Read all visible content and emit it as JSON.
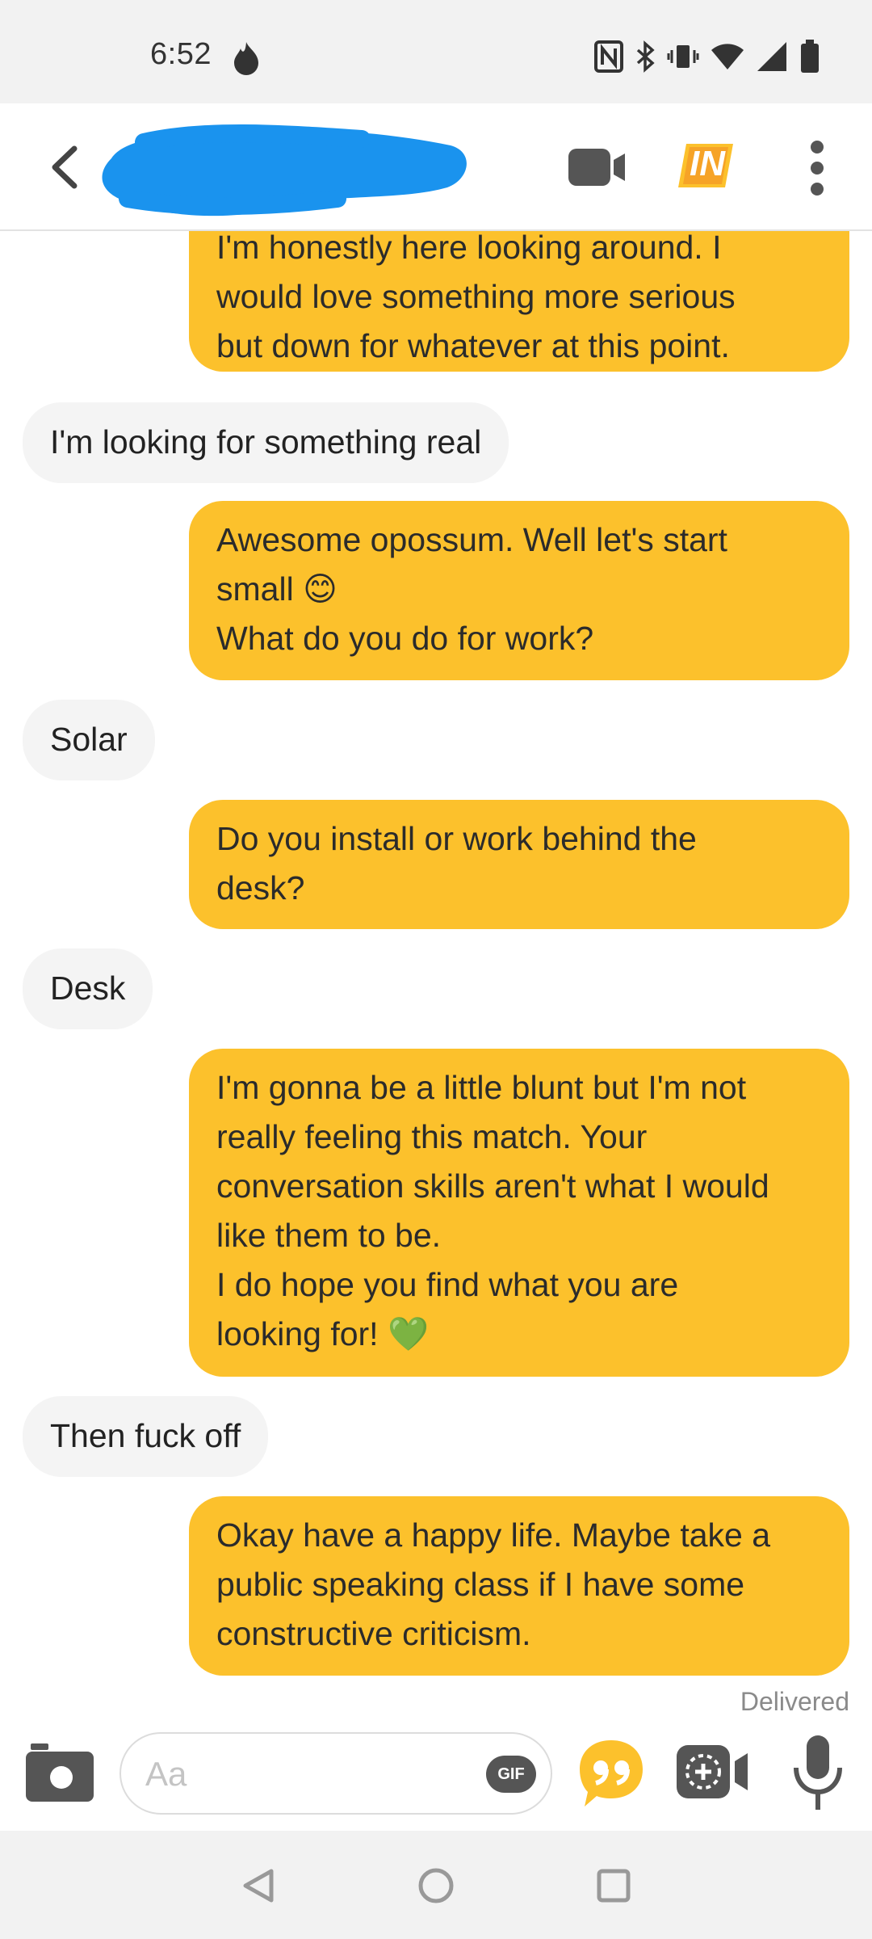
{
  "status_bar": {
    "time": "6:52",
    "icons": [
      "flame-icon",
      "nfc-icon",
      "bluetooth-icon",
      "vibrate-icon",
      "wifi-icon",
      "signal-icon",
      "battery-icon"
    ]
  },
  "header": {
    "contact_name": "",
    "badge_text": "IN",
    "accent_color": "#fcc12c"
  },
  "messages": [
    {
      "sender": "me",
      "text": "I'm honestly here looking around. I\nwould love something more serious\nbut down for whatever at this point."
    },
    {
      "sender": "them",
      "text": "I'm looking for something real"
    },
    {
      "sender": "me",
      "text": "Awesome opossum. Well let's start\nsmall 😊\nWhat do you do for work?"
    },
    {
      "sender": "them",
      "text": "Solar"
    },
    {
      "sender": "me",
      "text": "Do you install or work behind the\ndesk?"
    },
    {
      "sender": "them",
      "text": "Desk"
    },
    {
      "sender": "me",
      "text": "I'm gonna be a little blunt but I'm not\nreally feeling this match. Your\nconversation skills aren't what I would\nlike them to be.\nI do hope you find what you are\nlooking for! 💚"
    },
    {
      "sender": "them",
      "text": "Then fuck off"
    },
    {
      "sender": "me",
      "text": "Okay have a happy life. Maybe take a\npublic speaking class if I have some\nconstructive criticism."
    }
  ],
  "delivered_label": "Delivered",
  "composer": {
    "placeholder": "Aa",
    "value": "",
    "gif_label": "GIF"
  },
  "colors": {
    "sent_bubble": "#fcc12c",
    "received_bubble": "#f4f4f4",
    "redaction": "#1a93ee"
  }
}
